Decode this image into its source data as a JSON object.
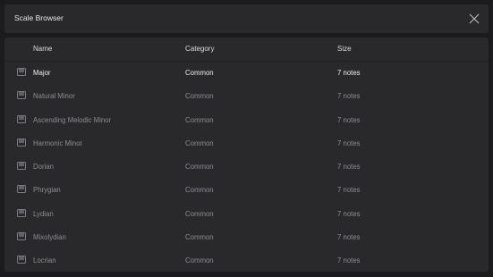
{
  "window": {
    "title": "Scale Browser"
  },
  "table": {
    "columns": {
      "name": "Name",
      "category": "Category",
      "size": "Size"
    },
    "rows": [
      {
        "name": "Major",
        "category": "Common",
        "size": "7 notes"
      },
      {
        "name": "Natural Minor",
        "category": "Common",
        "size": "7 notes"
      },
      {
        "name": "Ascending Melodic Minor",
        "category": "Common",
        "size": "7 notes"
      },
      {
        "name": "Harmonic Minor",
        "category": "Common",
        "size": "7 notes"
      },
      {
        "name": "Dorian",
        "category": "Common",
        "size": "7 notes"
      },
      {
        "name": "Phrygian",
        "category": "Common",
        "size": "7 notes"
      },
      {
        "name": "Lydian",
        "category": "Common",
        "size": "7 notes"
      },
      {
        "name": "Mixolydian",
        "category": "Common",
        "size": "7 notes"
      },
      {
        "name": "Locrian",
        "category": "Common",
        "size": "7 notes"
      }
    ],
    "selected_index": 0,
    "row_icon": "piano-keys-icon"
  },
  "colors": {
    "background": "#1b1b1d",
    "panel": "#29292c",
    "text_selected": "#ececef",
    "text_muted": "#8c8c91"
  }
}
